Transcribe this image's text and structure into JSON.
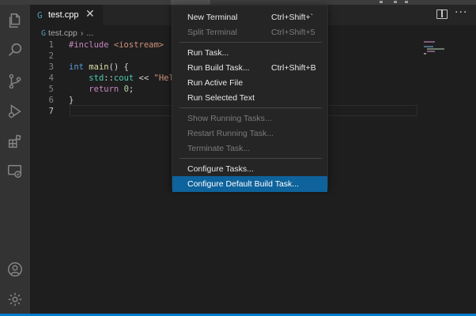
{
  "colors": {
    "accent": "#007acc",
    "menu_selected": "#0e639c",
    "editor_bg": "#1e1e1e",
    "activity_bg": "#333333"
  },
  "activity_bar": {
    "items": [
      {
        "icon": "files-icon"
      },
      {
        "icon": "search-icon"
      },
      {
        "icon": "source-control-icon"
      },
      {
        "icon": "run-debug-icon"
      },
      {
        "icon": "extensions-icon"
      },
      {
        "icon": "remote-explorer-icon"
      }
    ],
    "bottom": [
      {
        "icon": "account-icon"
      },
      {
        "icon": "manage-gear-icon"
      }
    ]
  },
  "tab": {
    "icon_glyph": "G",
    "title": "test.cpp",
    "close_glyph": "✕"
  },
  "toolbar": {
    "more_glyph": "···"
  },
  "breadcrumb": {
    "file": "test.cpp",
    "separator": "›",
    "rest": "..."
  },
  "editor": {
    "active_line": 7,
    "lines": [
      {
        "number": "1",
        "tokens": [
          {
            "t": "#include ",
            "c": "kw-p"
          },
          {
            "t": "<iostream>",
            "c": "str"
          }
        ]
      },
      {
        "number": "2",
        "tokens": []
      },
      {
        "number": "3",
        "tokens": [
          {
            "t": "int",
            "c": "kw-b"
          },
          {
            "t": " ",
            "c": "pl"
          },
          {
            "t": "main",
            "c": "fn"
          },
          {
            "t": "() {",
            "c": "pl"
          }
        ]
      },
      {
        "number": "4",
        "tokens": [
          {
            "t": "    ",
            "c": "pl"
          },
          {
            "t": "std",
            "c": "ty"
          },
          {
            "t": "::",
            "c": "pl"
          },
          {
            "t": "cout",
            "c": "ty"
          },
          {
            "t": " << ",
            "c": "pl"
          },
          {
            "t": "\"Hello",
            "c": "str"
          }
        ]
      },
      {
        "number": "5",
        "tokens": [
          {
            "t": "    ",
            "c": "pl"
          },
          {
            "t": "return",
            "c": "kw-p"
          },
          {
            "t": " ",
            "c": "pl"
          },
          {
            "t": "0",
            "c": "num"
          },
          {
            "t": ";",
            "c": "pl"
          }
        ]
      },
      {
        "number": "6",
        "tokens": [
          {
            "t": "}",
            "c": "pl"
          }
        ]
      },
      {
        "number": "7",
        "tokens": []
      }
    ]
  },
  "menu": {
    "groups": [
      [
        {
          "label": "New Terminal",
          "shortcut": "Ctrl+Shift+`",
          "disabled": false,
          "selected": false
        },
        {
          "label": "Split Terminal",
          "shortcut": "Ctrl+Shift+5",
          "disabled": true,
          "selected": false
        }
      ],
      [
        {
          "label": "Run Task...",
          "shortcut": "",
          "disabled": false,
          "selected": false
        },
        {
          "label": "Run Build Task...",
          "shortcut": "Ctrl+Shift+B",
          "disabled": false,
          "selected": false
        },
        {
          "label": "Run Active File",
          "shortcut": "",
          "disabled": false,
          "selected": false
        },
        {
          "label": "Run Selected Text",
          "shortcut": "",
          "disabled": false,
          "selected": false
        }
      ],
      [
        {
          "label": "Show Running Tasks...",
          "shortcut": "",
          "disabled": true,
          "selected": false
        },
        {
          "label": "Restart Running Task...",
          "shortcut": "",
          "disabled": true,
          "selected": false
        },
        {
          "label": "Terminate Task...",
          "shortcut": "",
          "disabled": true,
          "selected": false
        }
      ],
      [
        {
          "label": "Configure Tasks...",
          "shortcut": "",
          "disabled": false,
          "selected": false
        },
        {
          "label": "Configure Default Build Task...",
          "shortcut": "",
          "disabled": false,
          "selected": true
        }
      ]
    ]
  }
}
